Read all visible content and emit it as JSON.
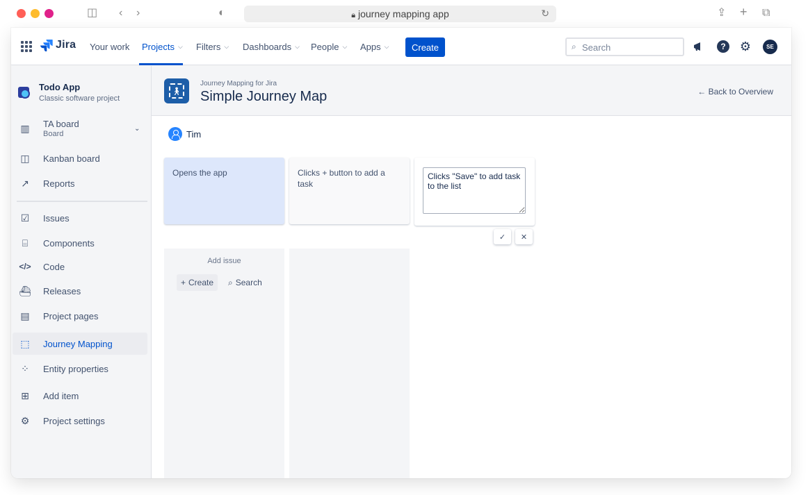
{
  "browser": {
    "url": "journey mapping app"
  },
  "topnav": {
    "product": "Jira",
    "items": [
      {
        "label": "Your work",
        "has_chevron": false
      },
      {
        "label": "Projects",
        "has_chevron": true,
        "active": true
      },
      {
        "label": "Filters",
        "has_chevron": true
      },
      {
        "label": "Dashboards",
        "has_chevron": true
      },
      {
        "label": "People",
        "has_chevron": true
      },
      {
        "label": "Apps",
        "has_chevron": true
      }
    ],
    "create_label": "Create",
    "search_placeholder": "Search",
    "avatar_initials": "SE",
    "accent_color": "#0052cc"
  },
  "sidebar": {
    "project_name": "Todo App",
    "project_type": "Classic software project",
    "board": {
      "title": "TA board",
      "subtitle": "Board"
    },
    "items": [
      {
        "label": "Kanban board",
        "icon": "kanban-icon"
      },
      {
        "label": "Reports",
        "icon": "reports-icon"
      },
      {
        "label": "Issues",
        "icon": "issues-icon"
      },
      {
        "label": "Components",
        "icon": "components-icon"
      },
      {
        "label": "Code",
        "icon": "code-icon"
      },
      {
        "label": "Releases",
        "icon": "releases-icon"
      },
      {
        "label": "Project pages",
        "icon": "pages-icon"
      },
      {
        "label": "Journey Mapping",
        "icon": "journey-mapping-icon",
        "active": true
      },
      {
        "label": "Entity properties",
        "icon": "entity-properties-icon"
      },
      {
        "label": "Add item",
        "icon": "add-item-icon"
      },
      {
        "label": "Project settings",
        "icon": "settings-icon"
      }
    ]
  },
  "main": {
    "app_label": "Journey Mapping for Jira",
    "title": "Simple Journey Map",
    "back_label": "Back to Overview",
    "persona": "Tim",
    "steps": [
      {
        "text": "Opens the app",
        "state": "highlighted"
      },
      {
        "text": "Clicks + button to add a task",
        "state": "normal"
      },
      {
        "text": "Clicks \"Save\" to add task to the list",
        "state": "editing"
      }
    ],
    "add_issue_label": "Add issue",
    "create_issue_label": "Create",
    "search_issue_label": "Search"
  }
}
